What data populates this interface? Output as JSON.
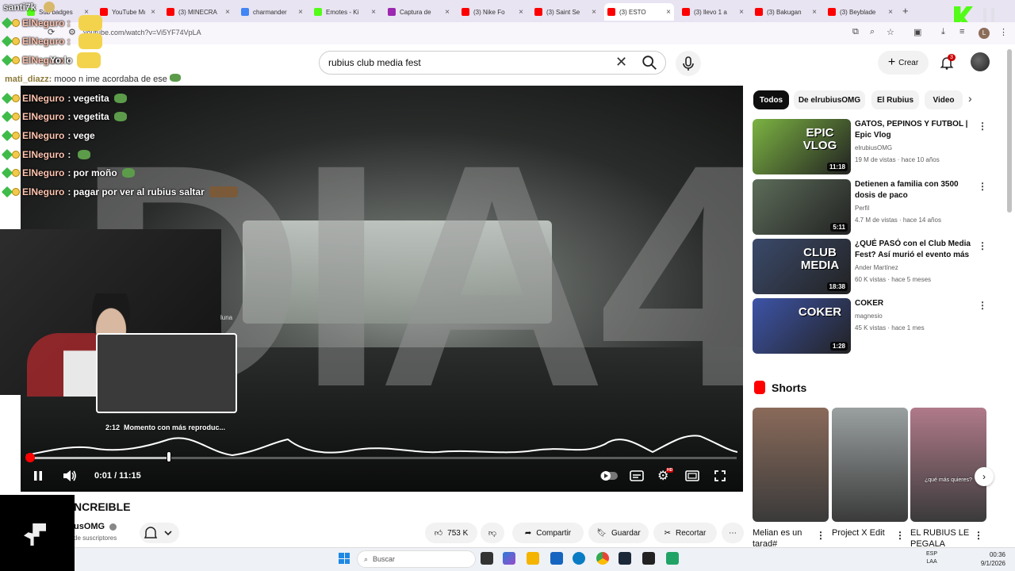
{
  "browser": {
    "tabs": [
      {
        "label": "Sub badges",
        "color": "#53fc18"
      },
      {
        "label": "YouTube Mu",
        "color": "#ff0000"
      },
      {
        "label": "(3) MINECRA",
        "color": "#ff0000"
      },
      {
        "label": "charmander",
        "color": "#4285f4"
      },
      {
        "label": "Emotes - Ki",
        "color": "#53fc18"
      },
      {
        "label": "Captura de",
        "color": "#9c27b0"
      },
      {
        "label": "(3) Nike Fo",
        "color": "#ff0000"
      },
      {
        "label": "(3) Saint Se",
        "color": "#ff0000"
      },
      {
        "label": "(3) ESTO",
        "color": "#ff0000"
      },
      {
        "label": "(3) llevo 1 a",
        "color": "#ff0000"
      },
      {
        "label": "(3) Bakugan",
        "color": "#ff0000"
      },
      {
        "label": "(3) Beyblade",
        "color": "#ff0000"
      }
    ],
    "new_tab": "+",
    "url": "youtube.com/watch?v=Vi5YF74VpLA",
    "profile_initial": "L"
  },
  "header": {
    "search_query": "rubius club media fest",
    "create_label": "Crear",
    "notif_count": "3"
  },
  "chat": {
    "top_user": "santi7k",
    "lines": [
      {
        "user": "ElNegurо",
        "text": ""
      },
      {
        "user": "ElNeguro",
        "text": ""
      },
      {
        "user": "ElNeguro",
        "text": "vegetita"
      },
      {
        "user": "ElNeguro",
        "text": "vegetita"
      },
      {
        "user": "ElNeguro",
        "text": "vege"
      },
      {
        "user": "ElNeguro",
        "text": ""
      },
      {
        "user": "ElNeguro",
        "text": "por moño"
      },
      {
        "user": "ElNeguro",
        "text": "pagar por ver al rubius saltar"
      }
    ],
    "mati_user": "mati_diazz",
    "mati_text": "mooo n ime acordaba de ese",
    "top_line_1": "ElNeguro :",
    "top_line_2": "ElNeguro :",
    "top_line_3": "ElNeguro :",
    "overlay_misc": "Yo lo"
  },
  "player": {
    "overlay_text": "DIA4",
    "preview_time": "2:12",
    "preview_label": "Momento con más reproduc...",
    "side_text": "luna",
    "current_time": "0:01",
    "duration": "11:15",
    "time_display": "0:01 / 11:15",
    "progress_fraction": 0.0015,
    "hover_fraction": 0.196,
    "hd_badge": "HD"
  },
  "video": {
    "title": "NCREIBLE",
    "channel": "usOMG",
    "subs": "de suscriptores",
    "likes": "753 K",
    "share": "Compartir",
    "save": "Guardar",
    "clip": "Recortar"
  },
  "sidebar": {
    "chips": [
      "Todos",
      "De elrubiusOMG",
      "El Rubius",
      "Video"
    ],
    "related": [
      {
        "title": "GATOS, PEPINOS Y FUTBOL | Epic Vlog",
        "channel": "elrubiusOMG",
        "meta": "19 M de vistas · hace 10 años",
        "duration": "11:18",
        "thumb": "#7cb342",
        "thumb_text": "EPIC VLOG"
      },
      {
        "title": "Detienen a familia con 3500 dosis de paco",
        "channel": "Perfil",
        "meta": "4.7 M de vistas · hace 14 años",
        "duration": "5:11",
        "thumb": "#5d6d5a",
        "thumb_text": ""
      },
      {
        "title": "¿QUÉ PASÓ con el Club Media Fest? Así murió el evento más ...",
        "channel": "Ander Martínez",
        "meta": "60 K vistas · hace 5 meses",
        "duration": "18:38",
        "thumb": "#3b4a6b",
        "thumb_text": "CLUB MEDIA"
      },
      {
        "title": "COKER",
        "channel": "magnesio",
        "meta": "45 K vistas · hace 1 mes",
        "duration": "1:28",
        "thumb": "#3d54a8",
        "thumb_text": "COKER"
      }
    ],
    "shorts_heading": "Shorts",
    "shorts": [
      {
        "title": "Melian es un tarad#",
        "color": "#8a6a5a"
      },
      {
        "title": "Project X Edit",
        "color": "#9aa0a0"
      },
      {
        "title": "EL RUBIUS LE PEGALA",
        "color": "#b07a8a",
        "caption": "¿qué más quieres?"
      }
    ]
  },
  "taskbar": {
    "search": "Buscar",
    "lang": "ESP",
    "lang2": "LAA",
    "time": "00:36",
    "date": "9/1/2026"
  }
}
